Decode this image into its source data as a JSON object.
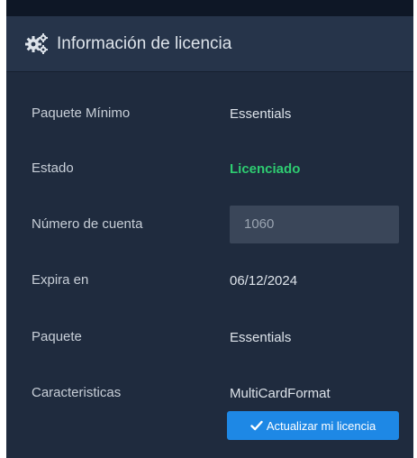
{
  "panel": {
    "title": "Información de licencia",
    "title_icon": "gears-icon"
  },
  "fields": {
    "minimum_package": {
      "label": "Paquete Mínimo",
      "value": "Essentials"
    },
    "status": {
      "label": "Estado",
      "value": "Licenciado",
      "color": "#2ecc71"
    },
    "account_number": {
      "label": "Número de cuenta",
      "value": "1060"
    },
    "expires": {
      "label": "Expira en",
      "value": "06/12/2024"
    },
    "package": {
      "label": "Paquete",
      "value": "Essentials"
    },
    "features": {
      "label": "Caracteristicas",
      "value": "MultiCardFormat"
    }
  },
  "actions": {
    "update_license_label": "Actualizar mi licencia",
    "update_license_icon": "check-icon",
    "button_color": "#1e88e5"
  },
  "colors": {
    "panel_background": "#1f2b3e",
    "header_background": "#26344a",
    "text": "#dde3ea"
  }
}
